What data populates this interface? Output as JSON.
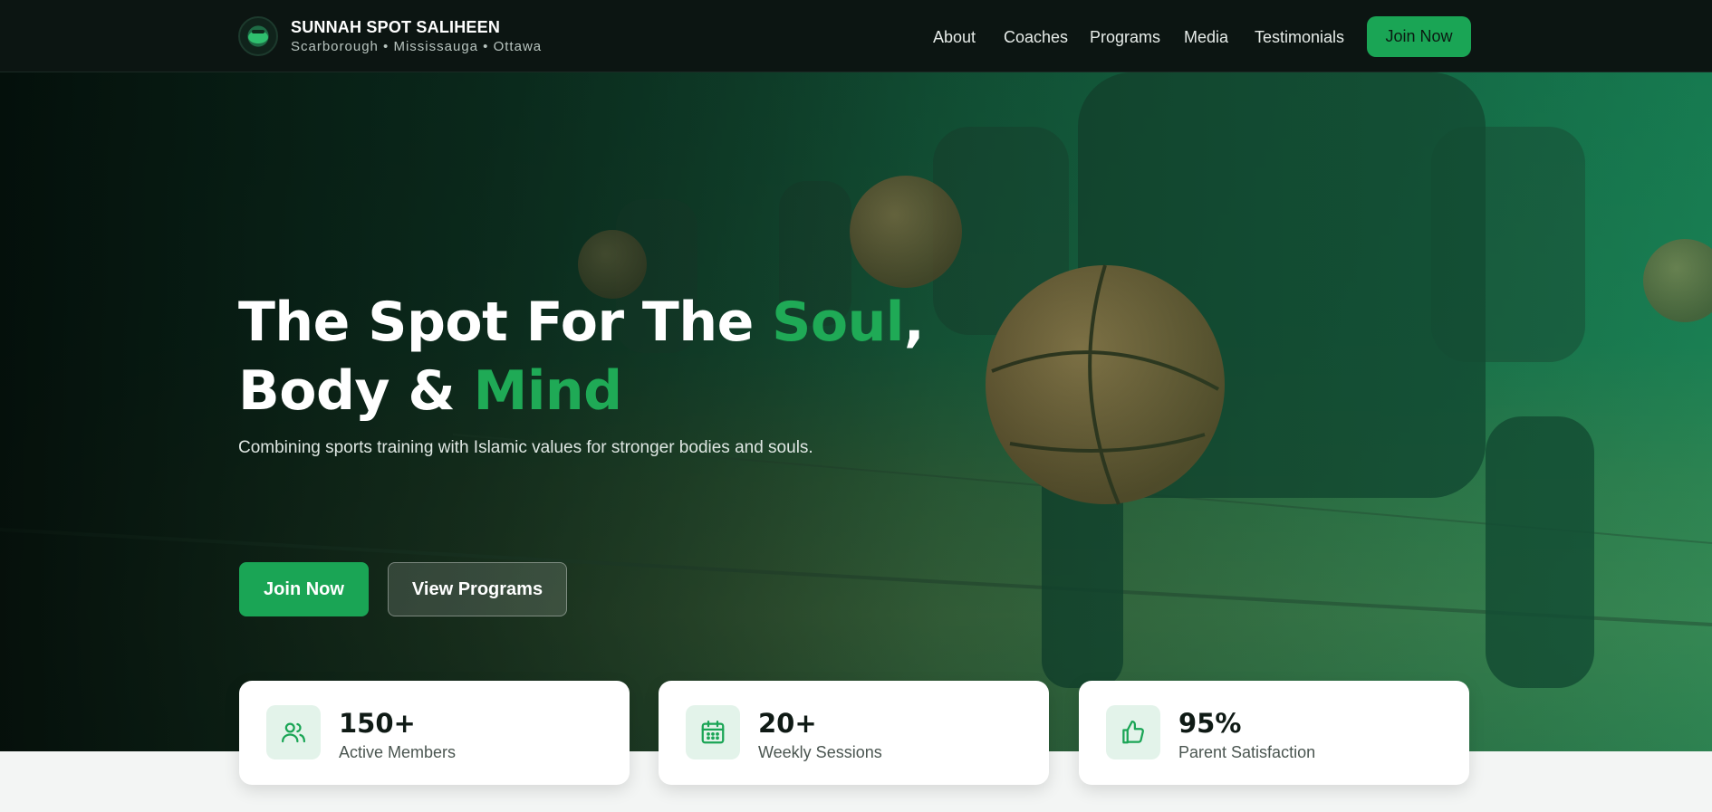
{
  "brand": {
    "name": "SUNNAH SPOT SALIHEEN",
    "locations": "Scarborough • Mississauga • Ottawa",
    "logo_icon": "club-logo-icon"
  },
  "nav": {
    "links": [
      "About",
      "Coaches",
      "Programs",
      "Media",
      "Testimonials"
    ],
    "cta": "Join Now"
  },
  "hero": {
    "title_part1": "The Spot For The ",
    "title_accent1": "Soul",
    "title_part2": ", Body & ",
    "title_accent2": "Mind",
    "subtitle": "Combining sports training with Islamic values for stronger bodies and souls.",
    "primary_button": "Join Now",
    "secondary_button": "View Programs"
  },
  "stats": [
    {
      "value": "150+",
      "label": "Active Members",
      "icon": "users-icon"
    },
    {
      "value": "20+",
      "label": "Weekly Sessions",
      "icon": "calendar-icon"
    },
    {
      "value": "95%",
      "label": "Parent Satisfaction",
      "icon": "thumbs-up-icon"
    }
  ],
  "colors": {
    "accent": "#1aa555",
    "header_bg": "#0c1512",
    "stat_icon_bg": "#e3f3ea"
  }
}
